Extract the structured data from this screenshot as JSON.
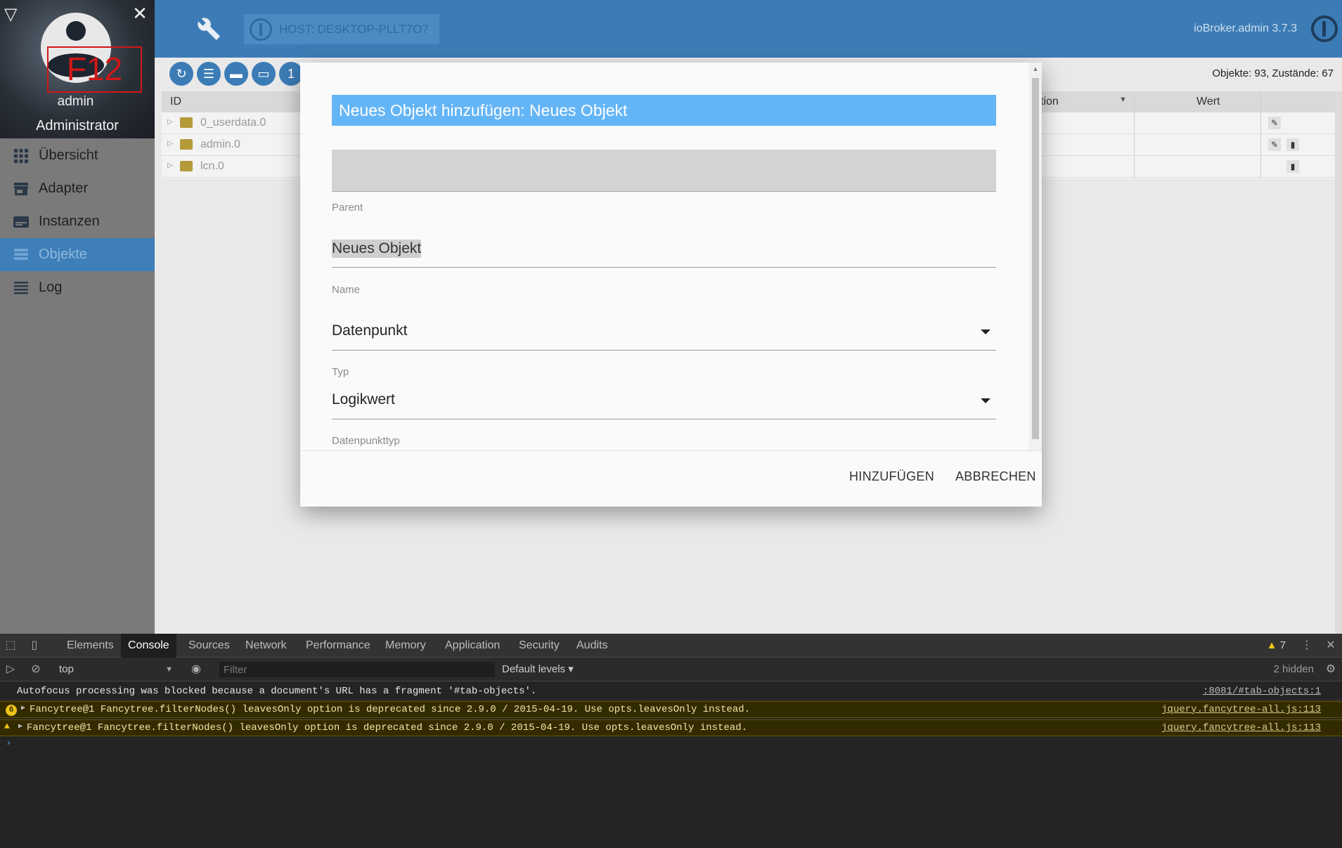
{
  "sidebar": {
    "close_label": "✕",
    "f12_label": "F12",
    "user_name": "admin",
    "user_role": "Administrator",
    "items": [
      {
        "label": "Übersicht",
        "icon": "grid-icon"
      },
      {
        "label": "Adapter",
        "icon": "store-icon"
      },
      {
        "label": "Instanzen",
        "icon": "instances-icon"
      },
      {
        "label": "Objekte",
        "icon": "list-table-icon",
        "active": true
      },
      {
        "label": "Log",
        "icon": "log-lines-icon"
      }
    ],
    "active_color": "#3e7fb9"
  },
  "header": {
    "host_label": "HOST: DESKTOP-PLLT7O7",
    "version": "ioBroker.admin 3.7.3",
    "bg_color": "#3c7cb6"
  },
  "toolbar": {
    "object_count": "Objekte: 93, Zustände: 67",
    "extra_button_label": "1"
  },
  "tree": {
    "headers": {
      "id": "ID",
      "func": "tion",
      "value": "Wert"
    },
    "rows": [
      {
        "name": "0_userdata.0"
      },
      {
        "name": "admin.0"
      },
      {
        "name": "lcn.0"
      }
    ]
  },
  "dialog": {
    "title": "Neues Objekt hinzufügen: Neues Objekt",
    "parent_label": "Parent",
    "name_value": "Neues Objekt",
    "name_label": "Name",
    "type_value": "Datenpunkt",
    "type_label": "Typ",
    "datatype_value": "Logikwert",
    "datatype_label": "Datenpunkttyp",
    "add_button": "HINZUFÜGEN",
    "cancel_button": "ABBRECHEN",
    "title_color": "#64b5f6"
  },
  "devtools": {
    "tabs": [
      "Elements",
      "Console",
      "Sources",
      "Network",
      "Performance",
      "Memory",
      "Application",
      "Security",
      "Audits"
    ],
    "active_tab": "Console",
    "warning_count": "7",
    "context": "top",
    "filter_placeholder": "Filter",
    "levels": "Default levels ▾",
    "hidden": "2 hidden",
    "messages": [
      {
        "level": "info",
        "text": "Autofocus processing was blocked because a document's URL has a fragment '#tab-objects'.",
        "source": ":8081/#tab-objects:1"
      },
      {
        "level": "warn",
        "count": "6",
        "text": "Fancytree@1 Fancytree.filterNodes() leavesOnly option is deprecated since 2.9.0 / 2015-04-19. Use opts.leavesOnly instead.",
        "source": "jquery.fancytree-all.js:113"
      },
      {
        "level": "warn",
        "text": "Fancytree@1 Fancytree.filterNodes() leavesOnly option is deprecated since 2.9.0 / 2015-04-19. Use opts.leavesOnly instead.",
        "source": "jquery.fancytree-all.js:113"
      }
    ],
    "prompt": "›"
  }
}
